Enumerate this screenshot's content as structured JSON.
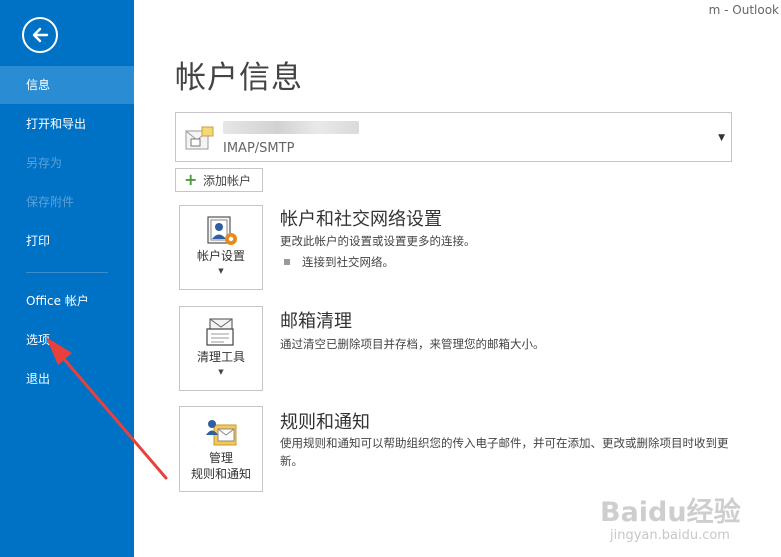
{
  "titlebar": {
    "text": "m - Outlook"
  },
  "sidebar": {
    "items": [
      {
        "label": "信息",
        "active": true,
        "disabled": false
      },
      {
        "label": "打开和导出",
        "active": false,
        "disabled": false
      },
      {
        "label": "另存为",
        "active": false,
        "disabled": true
      },
      {
        "label": "保存附件",
        "active": false,
        "disabled": true
      },
      {
        "label": "打印",
        "active": false,
        "disabled": false
      },
      {
        "label": "Office 帐户",
        "active": false,
        "disabled": false
      },
      {
        "label": "选项",
        "active": false,
        "disabled": false
      },
      {
        "label": "退出",
        "active": false,
        "disabled": false
      }
    ]
  },
  "main": {
    "title": "帐户信息",
    "account": {
      "type": "IMAP/SMTP"
    },
    "add_account_label": "添加帐户",
    "sections": [
      {
        "tile_label": "帐户设置",
        "title": "帐户和社交网络设置",
        "description": "更改此帐户的设置或设置更多的连接。",
        "bullet": "连接到社交网络。"
      },
      {
        "tile_label": "清理工具",
        "title": "邮箱清理",
        "description": "通过清空已删除项目并存档，来管理您的邮箱大小。"
      },
      {
        "tile_label_line1": "管理",
        "tile_label_line2": "规则和通知",
        "title": "规则和通知",
        "description": "使用规则和通知可以帮助组织您的传入电子邮件，并可在添加、更改或删除项目时收到更新。"
      }
    ]
  },
  "watermark": {
    "logo": "Baidu经验",
    "url": "jingyan.baidu.com"
  },
  "colors": {
    "sidebar": "#0072c6",
    "active_item": "#2a8dd4",
    "arrow": "#e8413c"
  }
}
